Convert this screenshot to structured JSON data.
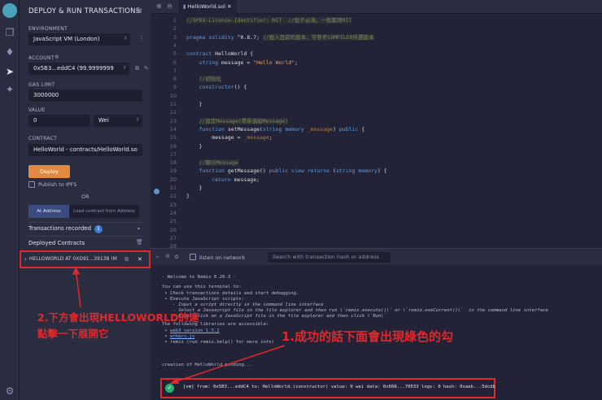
{
  "sidebar": {
    "icons": [
      "remix-logo-icon",
      "file-explorer-icon",
      "compiler-icon",
      "deploy-icon",
      "debugger-icon",
      "settings-icon"
    ]
  },
  "panel": {
    "title": "DEPLOY & RUN TRANSACTIONS",
    "environment": {
      "label": "ENVIRONMENT",
      "value": "JavaScript VM (London)"
    },
    "account": {
      "label": "ACCOUNT",
      "value": "0x5B3...eddC4 (99.9999999"
    },
    "gas_limit": {
      "label": "GAS LIMIT",
      "value": "3000000"
    },
    "value": {
      "label": "VALUE",
      "amount": "0",
      "unit": "Wei"
    },
    "contract": {
      "label": "CONTRACT",
      "value": "HelloWorld - contracts/HelloWorld.so"
    },
    "deploy_label": "Deploy",
    "publish_label": "Publish to IPFS",
    "or_label": "OR",
    "at_address_label": "At Address",
    "load_contract_label": "Load contract from Address",
    "transactions_recorded_label": "Transactions recorded",
    "transactions_recorded_count": "1",
    "deployed_contracts_label": "Deployed Contracts",
    "instance_label": "HELLOWORLD AT 0XD91...39138 (M"
  },
  "editor": {
    "tab_label": "HelloWorld.sol",
    "lines": [
      {
        "n": "1",
        "text": "//SPDX-License-Identifier: MIT  //如不必填，一般都用MIT"
      },
      {
        "n": "2",
        "text": ""
      },
      {
        "n": "3",
        "text": "pragma solidity ^0.8.7; //載入目前的版本，可參考COMPILER所選版本"
      },
      {
        "n": "4",
        "text": ""
      },
      {
        "n": "5",
        "text": "contract HelloWorld {"
      },
      {
        "n": "6",
        "text": "    string message = \"Hello World\";"
      },
      {
        "n": "7",
        "text": ""
      },
      {
        "n": "8",
        "text": "    //初始化"
      },
      {
        "n": "9",
        "text": "    constructor() {"
      },
      {
        "n": "10",
        "text": ""
      },
      {
        "n": "11",
        "text": "    }"
      },
      {
        "n": "12",
        "text": ""
      },
      {
        "n": "13",
        "text": "    //設定Message(帶新值給Message)"
      },
      {
        "n": "14",
        "text": "    function setMessage(string memory _message) public {"
      },
      {
        "n": "15",
        "text": "        message = _message;"
      },
      {
        "n": "16",
        "text": "    }"
      },
      {
        "n": "17",
        "text": ""
      },
      {
        "n": "18",
        "text": "    //顯示Message"
      },
      {
        "n": "19",
        "text": "    function getMessage() public view returns (string memory) {"
      },
      {
        "n": "20",
        "text": "        return message;"
      },
      {
        "n": "21",
        "text": "    }"
      },
      {
        "n": "22",
        "text": "}"
      },
      {
        "n": "23",
        "text": ""
      },
      {
        "n": "24",
        "text": ""
      },
      {
        "n": "25",
        "text": ""
      },
      {
        "n": "26",
        "text": ""
      },
      {
        "n": "27",
        "text": ""
      },
      {
        "n": "28",
        "text": ""
      }
    ]
  },
  "terminal": {
    "listen_label": "listen on network",
    "search_placeholder": "Search with transaction hash or address",
    "welcome": "- Welcome to Remix 0.20.3 -",
    "intro": "You can use this terminal to:",
    "bullet1": " • Check transactions details and start debugging.",
    "bullet2": " • Execute JavaScript scripts:",
    "bullet3": "    - Input a script directly in the command line interface",
    "bullet4": "    - Select a Javascript file in the file explorer and then run \\`remix.execute()\\` or \\`remix.exeCurrent()\\`  in the command line interface",
    "bullet5": "    - Right click on a JavaScript file in the file explorer and then click \\`Run\\`",
    "libs": "The following libraries are accessible:",
    "lib1": "web3 version 1.5.2",
    "lib2": "ethers.js",
    "lib3": " • remix (run remix.help() for more info)",
    "creation": "creation of HelloWorld pending...",
    "vm_line": "[vm]  from: 0x5B3...eddC4 to: HelloWorld.(constructor) value: 0 wei data: 0x608...70033 logs: 0 hash: 0xaeb...5dcdb"
  },
  "annotations": {
    "note1": "1.成功的話下面會出現綠色的勾",
    "note2_line1": "2.下方會出現HELLOWORLD的連",
    "note2_line2": "點擊一下展開它"
  },
  "colors": {
    "accent": "#e28a41",
    "annotation": "#e0282d",
    "success": "#26b36d",
    "link_blue": "#3a7bd5"
  }
}
